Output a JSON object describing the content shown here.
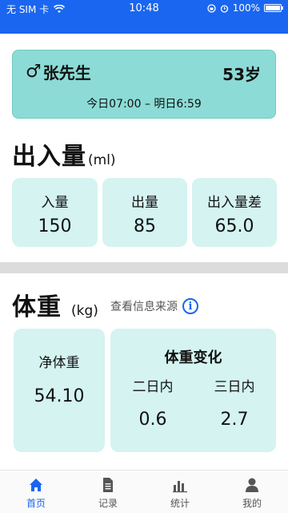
{
  "status_bar": {
    "carrier": "无 SIM 卡",
    "time": "10:48",
    "battery": "100%",
    "battery_level": 1.0
  },
  "patient": {
    "symbol": "♂",
    "name": "张先生",
    "age": "53岁",
    "time_range": "今日07:00 – 明日6:59"
  },
  "intake_output": {
    "title": "出入量",
    "unit": "(ml)",
    "items": [
      {
        "label": "入量",
        "value": "150"
      },
      {
        "label": "出量",
        "value": "85"
      },
      {
        "label": "出入量差",
        "value": "65.0"
      }
    ]
  },
  "weight": {
    "title": "体重",
    "unit": "(kg)",
    "info_link": "查看信息来源",
    "net_label": "净体重",
    "net_value": "54.10",
    "change_title": "体重变化",
    "changes": [
      {
        "label": "二日内",
        "value": "0.6"
      },
      {
        "label": "三日内",
        "value": "2.7"
      }
    ]
  },
  "tabs": [
    {
      "label": "首页",
      "icon": "home-icon",
      "active": true
    },
    {
      "label": "记录",
      "icon": "document-icon",
      "active": false
    },
    {
      "label": "统计",
      "icon": "bar-chart-icon",
      "active": false
    },
    {
      "label": "我的",
      "icon": "user-icon",
      "active": false
    }
  ],
  "colors": {
    "accent": "#1a66f0",
    "card_teal": "#8cdbd6",
    "box_light": "#d4f3f1"
  }
}
